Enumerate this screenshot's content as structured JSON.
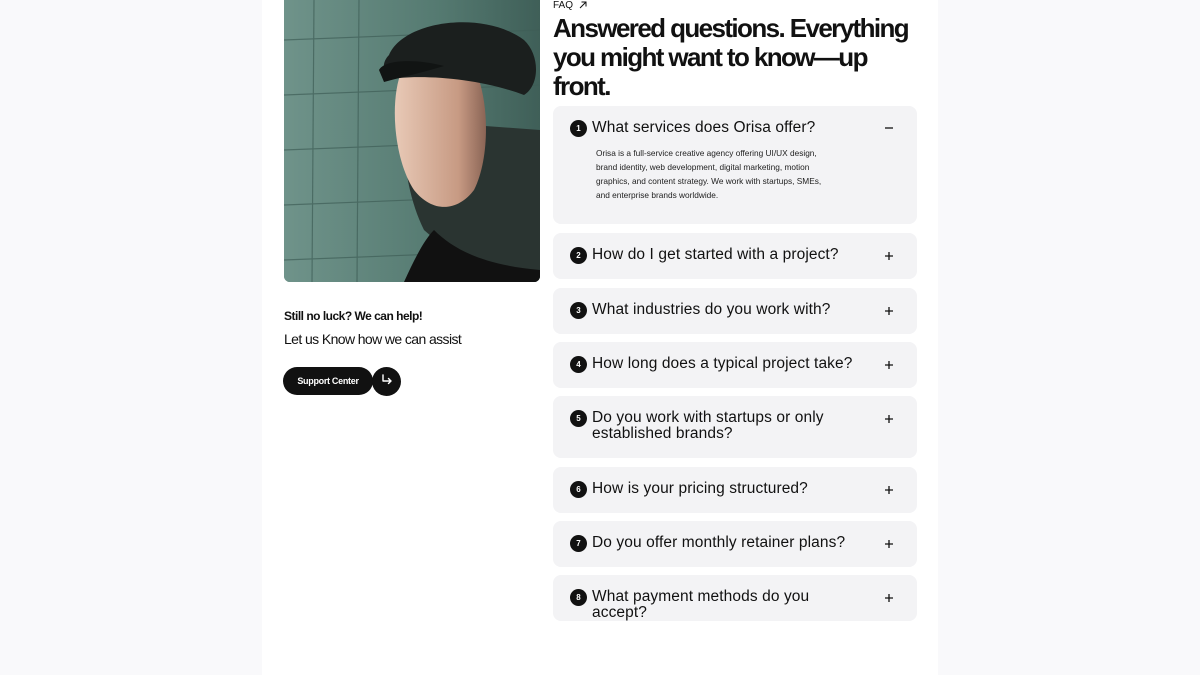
{
  "eyebrow": {
    "label": "FAQ",
    "icon": "arrow-up-right-icon"
  },
  "headline": "Answered questions. Everything you might want to know—up front.",
  "help": {
    "title": "Still no luck? We can help!",
    "subtitle": "Let us Know how we can assist",
    "button_label": "Support Center",
    "button_icon": "return-arrow-icon"
  },
  "faq": [
    {
      "num": "1",
      "question": "What services does Orisa offer?",
      "expanded": true,
      "toggle_icon": "minus-icon",
      "answer": "Orisa is a full-service creative agency offering UI/UX design, brand identity, web development, digital marketing, motion graphics, and content strategy. We work with startups, SMEs, and enterprise brands worldwide."
    },
    {
      "num": "2",
      "question": "How do I get started with a project?",
      "expanded": false,
      "toggle_icon": "plus-icon"
    },
    {
      "num": "3",
      "question": "What industries do you work with?",
      "expanded": false,
      "toggle_icon": "plus-icon"
    },
    {
      "num": "4",
      "question": "How long does a typical project take?",
      "expanded": false,
      "toggle_icon": "plus-icon"
    },
    {
      "num": "5",
      "question": "Do you work with startups or only established brands?",
      "expanded": false,
      "toggle_icon": "plus-icon"
    },
    {
      "num": "6",
      "question": "How is your pricing structured?",
      "expanded": false,
      "toggle_icon": "plus-icon"
    },
    {
      "num": "7",
      "question": "Do you offer monthly retainer plans?",
      "expanded": false,
      "toggle_icon": "plus-icon"
    },
    {
      "num": "8",
      "question": "What payment methods do you accept?",
      "expanded": false,
      "toggle_icon": "plus-icon"
    }
  ],
  "colors": {
    "card_bg": "#f3f3f5",
    "accent": "#111111",
    "photo_bg": "#5d8078"
  }
}
